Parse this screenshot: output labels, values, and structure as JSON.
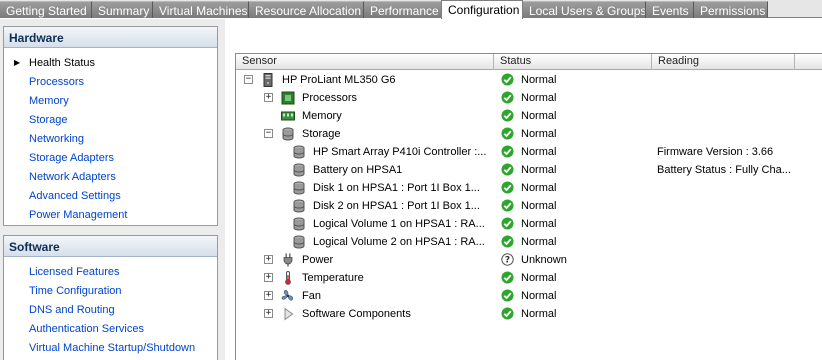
{
  "tabs": [
    "Getting Started",
    "Summary",
    "Virtual Machines",
    "Resource Allocation",
    "Performance",
    "Configuration",
    "Local Users & Groups",
    "Events",
    "Permissions"
  ],
  "hardware": {
    "title": "Hardware",
    "items": [
      "Health Status",
      "Processors",
      "Memory",
      "Storage",
      "Networking",
      "Storage Adapters",
      "Network Adapters",
      "Advanced Settings",
      "Power Management"
    ]
  },
  "software": {
    "title": "Software",
    "items": [
      "Licensed Features",
      "Time Configuration",
      "DNS and Routing",
      "Authentication Services",
      "Virtual Machine Startup/Shutdown"
    ]
  },
  "table": {
    "columns": [
      "Sensor",
      "Status",
      "Reading"
    ],
    "rows": [
      {
        "sensor": "HP ProLiant ML350 G6",
        "status": "Normal",
        "reading": ""
      },
      {
        "sensor": "Processors",
        "status": "Normal",
        "reading": ""
      },
      {
        "sensor": "Memory",
        "status": "Normal",
        "reading": ""
      },
      {
        "sensor": "Storage",
        "status": "Normal",
        "reading": ""
      },
      {
        "sensor": "HP Smart Array P410i Controller :...",
        "status": "Normal",
        "reading": "Firmware Version : 3.66"
      },
      {
        "sensor": "Battery on HPSA1",
        "status": "Normal",
        "reading": "Battery Status : Fully Cha..."
      },
      {
        "sensor": "Disk 1 on HPSA1 : Port 1I Box 1...",
        "status": "Normal",
        "reading": ""
      },
      {
        "sensor": "Disk 2 on HPSA1 : Port 1I Box 1...",
        "status": "Normal",
        "reading": ""
      },
      {
        "sensor": "Logical Volume 1 on HPSA1 : RA...",
        "status": "Normal",
        "reading": ""
      },
      {
        "sensor": "Logical Volume 2 on HPSA1 : RA...",
        "status": "Normal",
        "reading": ""
      },
      {
        "sensor": "Power",
        "status": "Unknown",
        "reading": ""
      },
      {
        "sensor": "Temperature",
        "status": "Normal",
        "reading": ""
      },
      {
        "sensor": "Fan",
        "status": "Normal",
        "reading": ""
      },
      {
        "sensor": "Software Components",
        "status": "Normal",
        "reading": ""
      }
    ]
  },
  "colors": {
    "normal": "#2ea62e",
    "link": "#0044cc",
    "header": "#0d2e55"
  }
}
